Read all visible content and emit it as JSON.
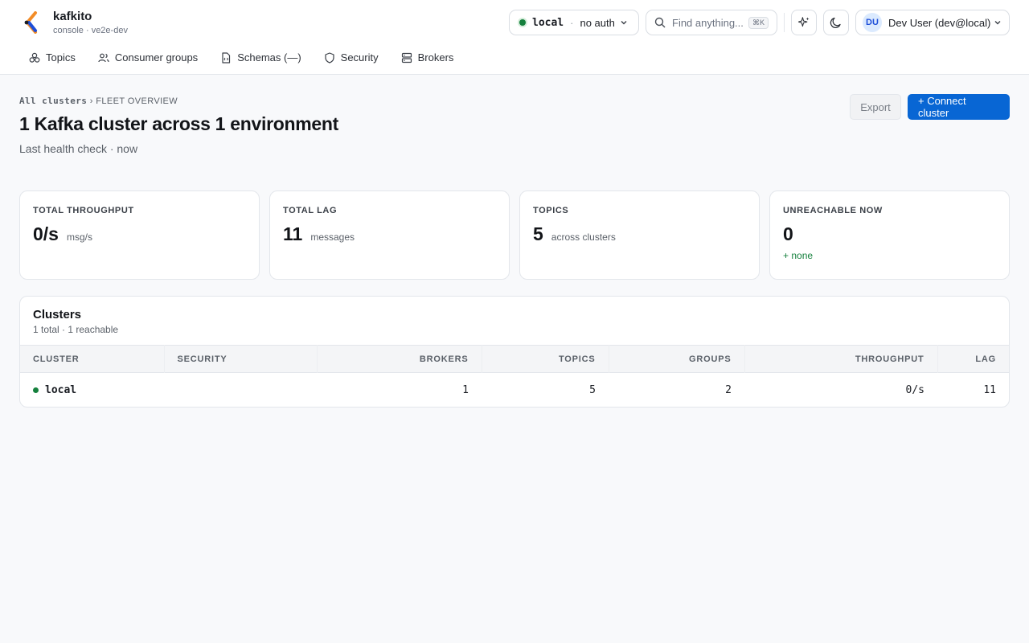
{
  "brand": {
    "name": "kafkito",
    "subtitle": "console · ve2e-dev"
  },
  "cluster_selector": {
    "name": "local",
    "separator": "·",
    "auth": "no auth",
    "status_color": "#15803d"
  },
  "search": {
    "placeholder": "Find anything...",
    "shortcut": "⌘K"
  },
  "user": {
    "initials": "DU",
    "label": "Dev User (dev@local)"
  },
  "nav": [
    {
      "label": "Topics",
      "icon": "topics-icon"
    },
    {
      "label": "Consumer groups",
      "icon": "users-icon"
    },
    {
      "label": "Schemas (—)",
      "icon": "file-code-icon"
    },
    {
      "label": "Security",
      "icon": "shield-icon"
    },
    {
      "label": "Brokers",
      "icon": "server-icon"
    }
  ],
  "breadcrumb": {
    "root": "All clusters",
    "separator": "›",
    "current": "FLEET OVERVIEW"
  },
  "page": {
    "title": "1 Kafka cluster across 1 environment",
    "subtitle": "Last health check · now"
  },
  "actions": {
    "export": "Export",
    "connect": "+ Connect cluster"
  },
  "stats": [
    {
      "label": "TOTAL THROUGHPUT",
      "value": "0/s",
      "unit": "msg/s",
      "delta": ""
    },
    {
      "label": "TOTAL LAG",
      "value": "11",
      "unit": "messages",
      "delta": ""
    },
    {
      "label": "TOPICS",
      "value": "5",
      "unit": "across clusters",
      "delta": ""
    },
    {
      "label": "UNREACHABLE NOW",
      "value": "0",
      "unit": "",
      "delta": "+ none"
    }
  ],
  "clusters_panel": {
    "title": "Clusters",
    "subtitle": "1 total · 1 reachable",
    "columns": [
      "CLUSTER",
      "SECURITY",
      "BROKERS",
      "TOPICS",
      "GROUPS",
      "THROUGHPUT",
      "LAG"
    ],
    "rows": [
      {
        "name": "local",
        "security": "",
        "brokers": "1",
        "topics": "5",
        "groups": "2",
        "throughput": "0/s",
        "lag": "11"
      }
    ]
  },
  "colors": {
    "accent": "#0866d4",
    "healthy": "#15803d"
  }
}
